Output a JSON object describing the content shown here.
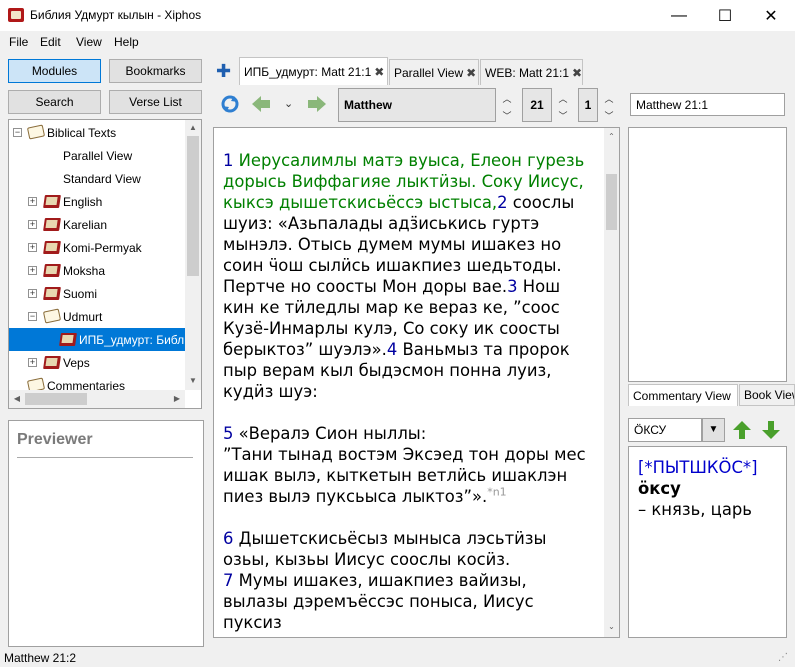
{
  "window": {
    "title": "Библия Удмурт кылын - Xiphos",
    "minimize_glyph": "—",
    "maximize_glyph": "☐",
    "close_glyph": "✕"
  },
  "menu": [
    "File",
    "Edit",
    "View",
    "Help"
  ],
  "sidebar": {
    "modules_label": "Modules",
    "bookmarks_label": "Bookmarks",
    "search_label": "Search",
    "verse_list_label": "Verse List",
    "tree": [
      {
        "label": "Biblical Texts",
        "type": "folder",
        "expander": "−"
      },
      {
        "label": "Parallel View",
        "type": "leaf"
      },
      {
        "label": "Standard View",
        "type": "leaf"
      },
      {
        "label": "English",
        "type": "book",
        "expander": "+"
      },
      {
        "label": "Karelian",
        "type": "book",
        "expander": "+"
      },
      {
        "label": "Komi-Permyak",
        "type": "book",
        "expander": "+"
      },
      {
        "label": "Moksha",
        "type": "book",
        "expander": "+"
      },
      {
        "label": "Suomi",
        "type": "book",
        "expander": "+"
      },
      {
        "label": "Udmurt",
        "type": "folder",
        "expander": "−"
      },
      {
        "label": "ИПБ_удмурт: Библ",
        "type": "book",
        "selected": true
      },
      {
        "label": "Veps",
        "type": "book",
        "expander": "+"
      },
      {
        "label": "Commentaries",
        "type": "folder"
      }
    ],
    "previewer_title": "Previewer"
  },
  "tabs": [
    {
      "label": "ИПБ_удмурт: Matt 21:1",
      "active": true
    },
    {
      "label": "Parallel View",
      "active": false
    },
    {
      "label": "WEB: Matt 21:1",
      "active": false
    }
  ],
  "tab_close_glyph": "✖",
  "add_tab_glyph": "✚",
  "navigation": {
    "book": "Matthew",
    "chapter": "21",
    "verse": "1",
    "reference": "Matthew 21:1"
  },
  "text": {
    "paragraphs": [
      [
        {
          "n": "1",
          "t": " Иерусалимлы матэ вуыса, Елеон гурезь дорысь Виффагияе лыктӥзы. Соку Иисус, кыксэ дышетскисьёссэ ыстыса,",
          "green": true
        },
        {
          "n": "2",
          "t": " сооcлы шуиз: «Азьпалады адӟиськись гуртэ мынэлэ. Отысь думем мумы ишакез но соин ӵош сылӥсь ишакпиез шедьтоды. Пертче но сооcты Мон доры вае."
        },
        {
          "n": "3",
          "t": " Нош кин ке тӥледлы мар ке вераз ке, ”соос Кузё-Инмарлы кулэ, Со соку ик сооcты берыктоз” шуэлэ»."
        },
        {
          "n": "4",
          "t": " Ваньмыз та пророк пыр верам кыл быдэсмон понна луиз, кудӥз шуэ:"
        }
      ],
      [
        {
          "n": "5",
          "t": " «Вералэ Сион ныллы:\n”Тани тынад востэм Эксэед тон доры мес ишак вылэ, кыткетын ветлӥсь ишаклэн пиез вылэ пуксьыса лыктоз”».",
          "note": "*n1"
        }
      ],
      [
        {
          "n": "6",
          "t": " Дышетскисьёсыз мыныса лэсьтӥзы озьы, кызьы Иисус сооcлы косӥз.\n"
        },
        {
          "n": "7",
          "t": " Мумы ишакез, ишакпиез вайизы, вылазы дэремъёссэс поныса, Иисус пуксиз"
        }
      ]
    ]
  },
  "commentary_tab": "Commentary View",
  "book_tab": "Book View",
  "dictionary": {
    "entry": "ӦКСУ",
    "link": "[*ПЫТШКӦС*]",
    "headword": "ӧксу",
    "definition": "– князь, царь"
  },
  "status": "Matthew 21:2"
}
